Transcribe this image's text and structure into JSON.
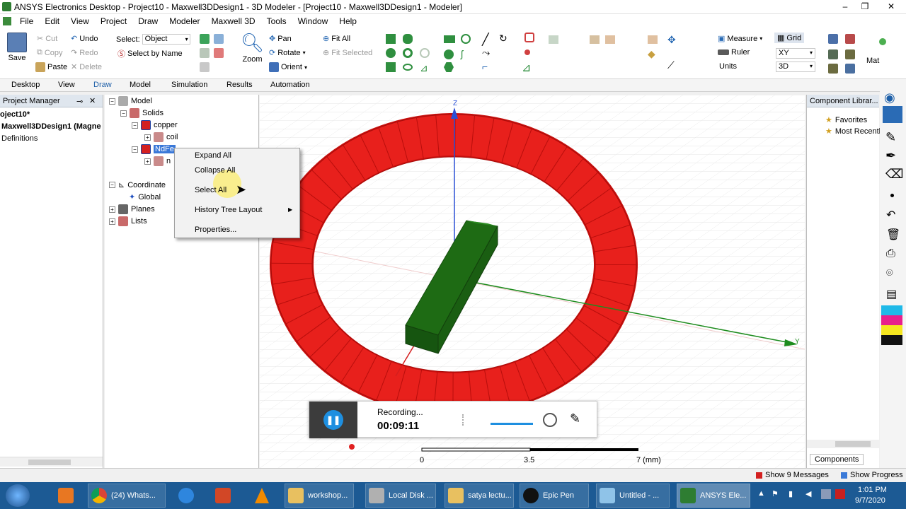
{
  "title": "ANSYS Electronics Desktop - Project10 - Maxwell3DDesign1 - 3D Modeler - [Project10 - Maxwell3DDesign1 - Modeler]",
  "menu": [
    "File",
    "Edit",
    "View",
    "Project",
    "Draw",
    "Modeler",
    "Maxwell 3D",
    "Tools",
    "Window",
    "Help"
  ],
  "ribbon": {
    "save": "Save",
    "cut": "Cut",
    "copy": "Copy",
    "paste": "Paste",
    "undo": "Undo",
    "redo": "Redo",
    "delete": "Delete",
    "select_label": "Select:",
    "select_value": "Object",
    "select_by_name": "Select by Name",
    "zoom": "Zoom",
    "pan": "Pan",
    "rotate": "Rotate",
    "orient": "Orient",
    "fit_all": "Fit All",
    "fit_selected": "Fit Selected",
    "measure": "Measure",
    "ruler": "Ruler",
    "units": "Units",
    "grid": "Grid",
    "plane": "XY",
    "mode": "3D",
    "mat": "Mat"
  },
  "tabs": [
    "Desktop",
    "View",
    "Draw",
    "Model",
    "Simulation",
    "Results",
    "Automation"
  ],
  "active_tab": "Draw",
  "project_manager": {
    "header": "Project Manager",
    "items": [
      "oject10*",
      "Maxwell3DDesign1 (Magne",
      "Definitions"
    ]
  },
  "tree": {
    "model": "Model",
    "solids": "Solids",
    "copper": "copper",
    "coil": "coil",
    "ndfe": "NdFe",
    "ndfe_child": "n",
    "coordinate": "Coordinate",
    "global": "Global",
    "planes": "Planes",
    "lists": "Lists"
  },
  "context_menu": {
    "expand_all": "Expand All",
    "collapse_all": "Collapse All",
    "select_all": "Select All",
    "history_tree_layout": "History Tree Layout",
    "properties": "Properties..."
  },
  "viewport": {
    "axis_z": "Z",
    "axis_y": "Y",
    "scale_0": "0",
    "scale_mid": "3.5",
    "scale_end": "7 (mm)"
  },
  "recorder": {
    "status": "Recording...",
    "time": "00:09:11"
  },
  "component_library": {
    "header": "Component Librar...",
    "favorites": "Favorites",
    "most_recent": "Most Recentl",
    "tab": "Components"
  },
  "statusbar": {
    "messages": "Show 9 Messages",
    "progress": "Show Progress"
  },
  "taskbar": {
    "items": [
      "(24) Whats...",
      "workshop...",
      "Local Disk ...",
      "satya lectu...",
      "Epic Pen",
      "Untitled - ...",
      "ANSYS Ele..."
    ],
    "time": "1:01 PM",
    "date": "9/7/2020"
  },
  "colors": {
    "ring": "#e8201c",
    "block": "#1e6b14",
    "accent": "#1d5fa8"
  }
}
